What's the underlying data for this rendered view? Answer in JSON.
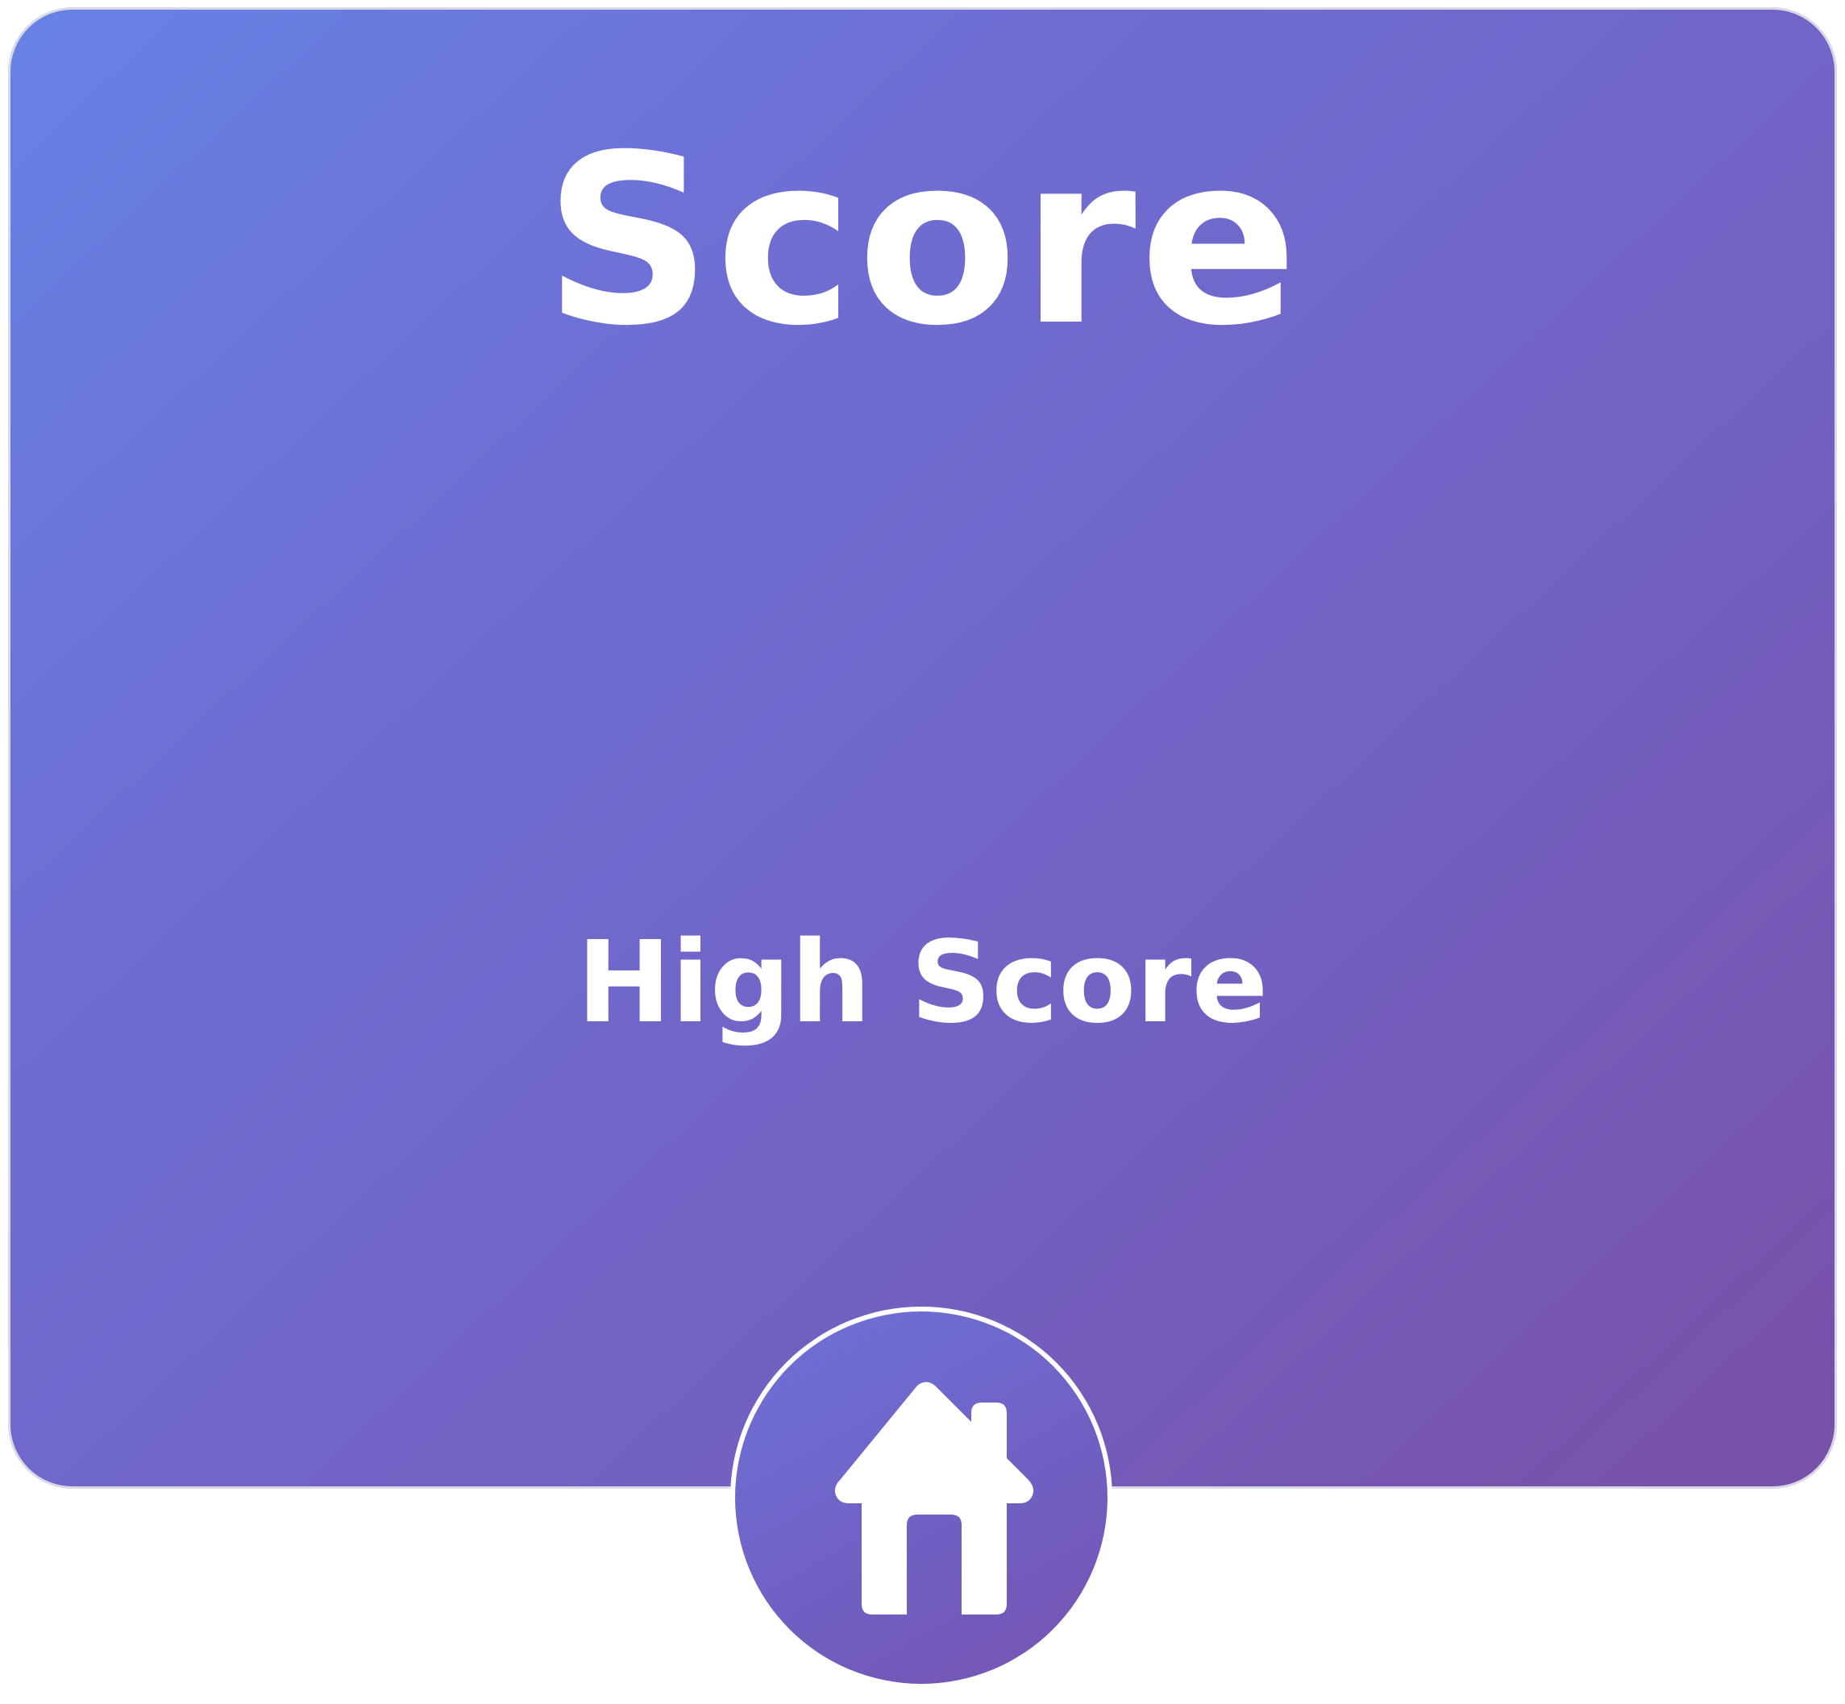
{
  "screen": {
    "title": "Score",
    "subtitle": "High Score"
  },
  "home_button": {
    "icon": "home-icon"
  },
  "colors": {
    "gradient_start": "#6782e6",
    "gradient_end": "#7850a8",
    "text": "#ffffff"
  }
}
